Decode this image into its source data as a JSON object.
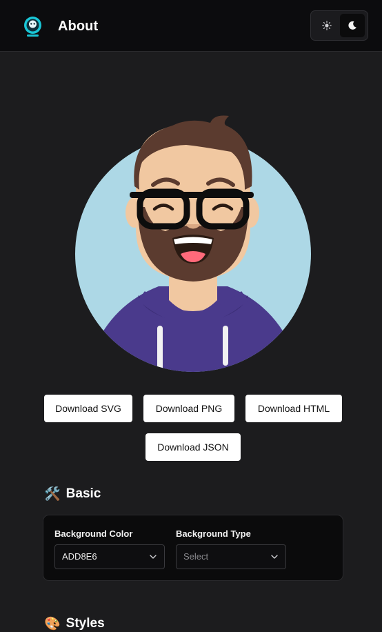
{
  "header": {
    "title": "About",
    "logo_icon": "bot-logo-icon",
    "theme_toggle": {
      "light_icon": "sun-icon",
      "dark_icon": "moon-icon",
      "selected": "dark"
    }
  },
  "avatar": {
    "background_color": "#ADD8E6",
    "hoodie_color": "#4a3a8c"
  },
  "downloads": {
    "svg_label": "Download SVG",
    "png_label": "Download PNG",
    "html_label": "Download HTML",
    "json_label": "Download JSON"
  },
  "basic": {
    "emoji": "🛠️",
    "title": "Basic",
    "background_color": {
      "label": "Background Color",
      "value": "ADD8E6"
    },
    "background_type": {
      "label": "Background Type",
      "placeholder": "Select"
    }
  },
  "styles": {
    "emoji": "🎨",
    "title": "Styles"
  }
}
